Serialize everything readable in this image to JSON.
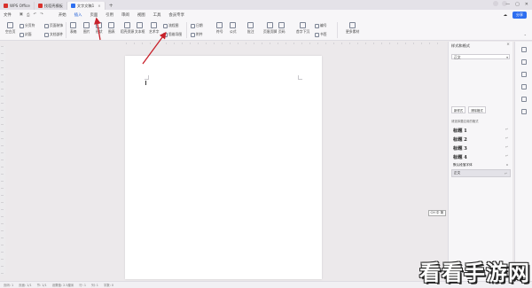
{
  "tabs": [
    {
      "label": "WPS Office",
      "color": "#d9302c"
    },
    {
      "label": "找稻壳模板",
      "color": "#d9302c"
    },
    {
      "label": "文字文稿1",
      "color": "#2e6ff0"
    }
  ],
  "new_tab": "+",
  "menu": {
    "file": "文件",
    "items": [
      "开始",
      "插入",
      "页面",
      "引用",
      "审阅",
      "视图",
      "工具",
      "会员专享"
    ],
    "active_index": 1,
    "share": "分享"
  },
  "ribbon": {
    "items_big": [
      "空白页",
      "分页",
      "表格",
      "图片",
      "形状",
      "图表",
      "稻壳资源",
      "文本框",
      "艺术字",
      "截屏",
      "符号",
      "公式",
      "批注",
      "页眉页脚",
      "页码",
      "水印",
      "超链接",
      "对象",
      "更多素材"
    ],
    "items_small": [
      "分页符",
      "空白页",
      "封面",
      "页面装饰",
      "文档部件",
      "流程图",
      "思维导图",
      "日期",
      "附件",
      "首字下沉",
      "编号",
      "书签",
      "交叉引用",
      "窗体",
      "对象"
    ]
  },
  "right_panel": {
    "title": "样式和格式",
    "current_style": "正文",
    "btn_new": "新样式",
    "btn_clear": "清除格式",
    "section_label": "请选择要应用的格式",
    "styles": [
      {
        "label": "标题 1",
        "mark": "↵",
        "heading": true
      },
      {
        "label": "标题 2",
        "mark": "↵",
        "heading": true
      },
      {
        "label": "标题 3",
        "mark": "↵",
        "heading": true
      },
      {
        "label": "标题 4",
        "mark": "↵",
        "heading": true
      },
      {
        "label": "默认段落字体",
        "mark": "a",
        "heading": false
      },
      {
        "label": "正文",
        "mark": "↵",
        "heading": false,
        "selected": true
      }
    ]
  },
  "chip": "CH 中 简",
  "status": [
    "页码: 1",
    "页面: 1/1",
    "节: 1/1",
    "设置值: 2.5厘米",
    "行: 1",
    "列: 1",
    "字数: 0"
  ],
  "watermark": "看看手游网",
  "colors": {
    "accent": "#1f5ed6",
    "arrow": "#c8202a"
  }
}
